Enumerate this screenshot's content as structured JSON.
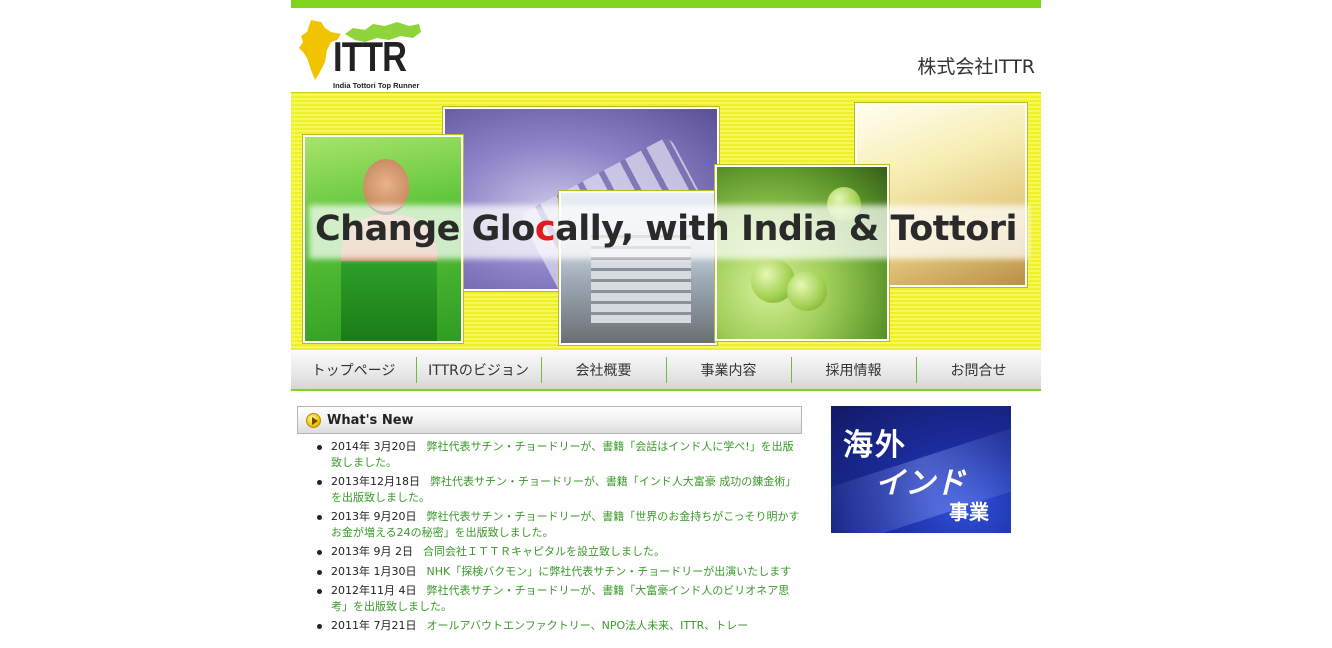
{
  "header": {
    "logo_text": "ITTR",
    "logo_subtitle": "India Tottori Top Runner",
    "company_name": "株式会社ITTR"
  },
  "hero": {
    "slogan_before": "Change Glo",
    "slogan_highlight": "c",
    "slogan_after": "ally, with India & Tottori"
  },
  "nav": {
    "items": [
      {
        "label": "トップページ"
      },
      {
        "label": "ITTRのビジョン"
      },
      {
        "label": "会社概要"
      },
      {
        "label": "事業内容"
      },
      {
        "label": "採用情報"
      },
      {
        "label": "お問合せ"
      }
    ]
  },
  "news": {
    "title": "What's New",
    "items": [
      {
        "date": "2014年 3月20日",
        "text": "弊社代表サチン・チョードリーが、書籍「会話はインド人に学べ!」を出版致しました。"
      },
      {
        "date": "2013年12月18日",
        "text": "弊社代表サチン・チョードリーが、書籍「インド人大富豪 成功の錬金術」を出版致しました。"
      },
      {
        "date": "2013年 9月20日",
        "text": "弊社代表サチン・チョードリーが、書籍「世界のお金持ちがこっそり明かすお金が増える24の秘密」を出版致しました。"
      },
      {
        "date": "2013年 9月 2日",
        "text": "合同会社ＩＴＴＲキャピタルを設立致しました。"
      },
      {
        "date": "2013年 1月30日",
        "text": "NHK「探検バクモン」に弊社代表サチン・チョードリーが出演いたします"
      },
      {
        "date": "2012年11月 4日",
        "text": "弊社代表サチン・チョードリーが、書籍「大富豪インド人のビリオネア思考」を出版致しました。"
      },
      {
        "date": "2011年 7月21日",
        "text": "オールアバウトエンファクトリー、NPO法人未来、ITTR、トレー"
      }
    ]
  },
  "banner": {
    "line1": "海外",
    "line2": "インド",
    "line3": "事業"
  },
  "colors": {
    "accent_green": "#7fd41e",
    "link_green": "#3a9a2a",
    "hero_yellow": "#eef02a",
    "banner_blue": "#1a2c9c"
  }
}
